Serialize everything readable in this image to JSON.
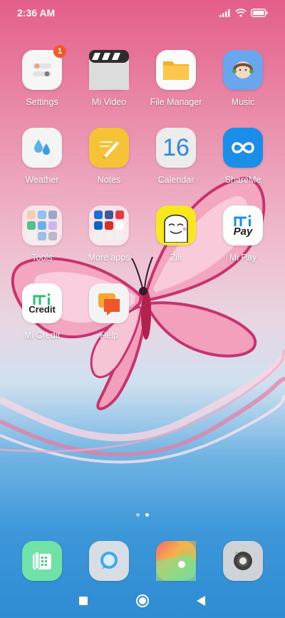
{
  "status_bar": {
    "time": "2:36 AM"
  },
  "apps": [
    {
      "label": "Settings",
      "icon": "settings-icon",
      "badge": "1"
    },
    {
      "label": "Mi Video",
      "icon": "mi-video-icon"
    },
    {
      "label": "File Manager",
      "icon": "file-manager-icon"
    },
    {
      "label": "Music",
      "icon": "music-icon"
    },
    {
      "label": "Weather",
      "icon": "weather-icon"
    },
    {
      "label": "Notes",
      "icon": "notes-icon"
    },
    {
      "label": "Calendar",
      "icon": "calendar-icon",
      "day": "16"
    },
    {
      "label": "ShareMe",
      "icon": "shareme-icon"
    },
    {
      "label": "Tools",
      "icon": "tools-folder-icon"
    },
    {
      "label": "More apps",
      "icon": "more-apps-folder-icon"
    },
    {
      "label": "Zili",
      "icon": "zili-icon"
    },
    {
      "label": "Mi Pay",
      "icon": "mi-pay-icon",
      "logo_text": "Pay"
    },
    {
      "label": "Mi Credit",
      "icon": "mi-credit-icon",
      "logo_text": "Credit"
    },
    {
      "label": "Help",
      "icon": "help-icon"
    }
  ],
  "page_indicator": {
    "pages": 2,
    "current": 2
  },
  "dock": [
    {
      "icon": "phone-icon"
    },
    {
      "icon": "messaging-icon"
    },
    {
      "icon": "browser-icon"
    },
    {
      "icon": "camera-icon"
    }
  ],
  "nav_bar": [
    {
      "icon": "recents-icon"
    },
    {
      "icon": "home-icon"
    },
    {
      "icon": "back-icon"
    }
  ],
  "colors": {
    "badge": "#f25a2b",
    "shareme": "#1a8ee8",
    "notes": "#f6c237",
    "file_manager": "#f8b02a"
  }
}
